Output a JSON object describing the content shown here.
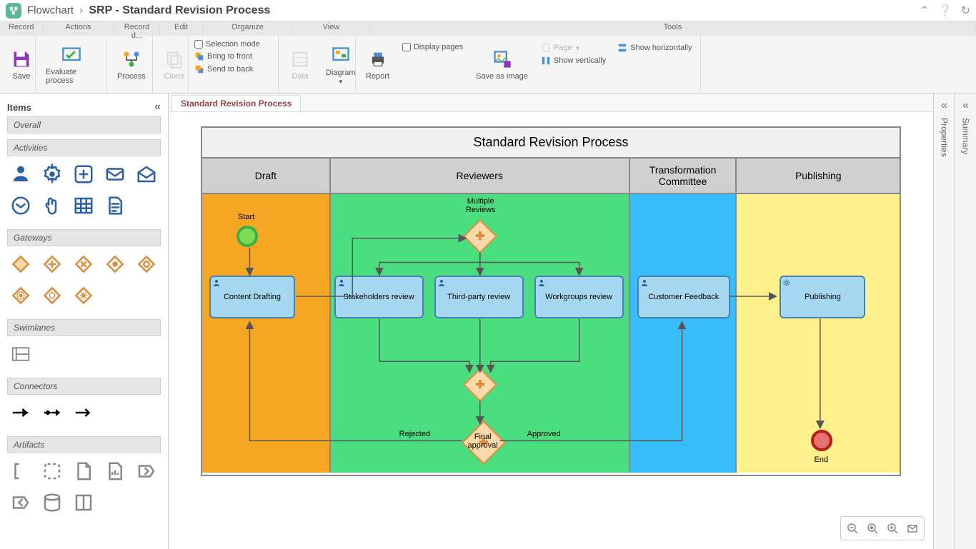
{
  "header": {
    "appName": "Flowchart",
    "pageTitle": "SRP - Standard Revision Process"
  },
  "ribbon": {
    "tabs": {
      "record": "Record",
      "actions": "Actions",
      "recordData": "Record d...",
      "edit": "Edit",
      "organize": "Organize",
      "view": "View",
      "tools": "Tools"
    },
    "buttons": {
      "save": "Save",
      "evaluate": "Evaluate process",
      "process": "Process",
      "clone": "Clone",
      "selectionMode": "Selection mode",
      "bringFront": "Bring to front",
      "sendBack": "Send to back",
      "data": "Data",
      "diagram": "Diagram",
      "report": "Report",
      "displayPages": "Display pages",
      "saveAsImage": "Save as image",
      "page": "Page",
      "showHorizontally": "Show horizontally",
      "showVertically": "Show vertically"
    }
  },
  "sidebar": {
    "title": "Items",
    "sections": {
      "overall": "Overall",
      "activities": "Activities",
      "gateways": "Gateways",
      "swimlanes": "Swimlanes",
      "connectors": "Connectors",
      "artifacts": "Artifacts"
    }
  },
  "canvas": {
    "tabName": "Standard Revision Process",
    "diagramTitle": "Standard Revision Process",
    "lanes": {
      "draft": "Draft",
      "reviewers": "Reviewers",
      "transformation": "Transformation Committee",
      "publishing": "Publishing"
    },
    "nodes": {
      "start": "Start",
      "contentDrafting": "Content Drafting",
      "multipleReviews": "Multiple Reviews",
      "stakeholdersReview": "Stakeholders review",
      "thirdPartyReview": "Third-party review",
      "workgroupsReview": "Workgroups review",
      "finalApproval": "Final approval",
      "rejected": "Rejected",
      "approved": "Approved",
      "customerFeedback": "Customer Feedback",
      "publishing": "Publishing",
      "end": "End"
    }
  },
  "rightPanels": {
    "properties": "Properties",
    "summary": "Summary"
  }
}
